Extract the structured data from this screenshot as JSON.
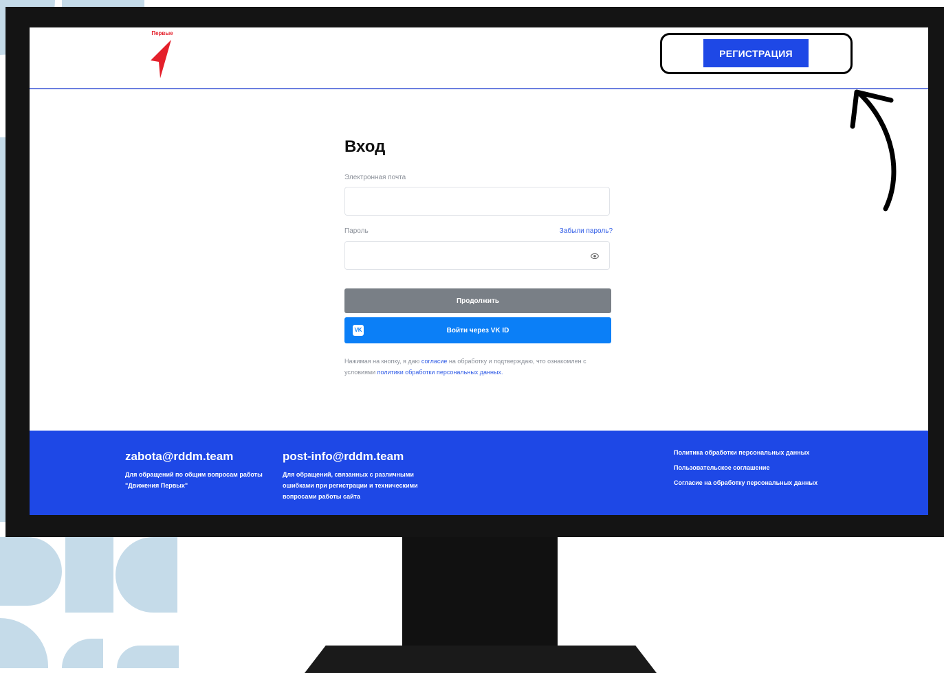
{
  "header": {
    "logo_text": "Первые",
    "register_label": "РЕГИСТРАЦИЯ"
  },
  "form": {
    "title": "Вход",
    "email_label": "Электронная почта",
    "password_label": "Пароль",
    "forgot_password": "Забыли пароль?",
    "continue_label": "Продолжить",
    "vk_login_label": "Войти через VK ID",
    "vk_icon_text": "VK",
    "consent": {
      "part1": "Нажимая на кнопку, я даю ",
      "link1": "согласие",
      "part2": " на обработку и подтверждаю, что ознакомлен с условиями ",
      "link2": "политики обработки персональных данных."
    }
  },
  "footer": {
    "contacts": [
      {
        "email": "zabota@rddm.team",
        "description": "Для обращений по общим вопросам работы \"Движения Первых\""
      },
      {
        "email": "post-info@rddm.team",
        "description": "Для обращений, связанных с различными ошибками при регистрации и техническими вопросами работы сайта"
      }
    ],
    "links": [
      "Политика обработки персональных данных",
      "Пользовательское соглашение",
      "Согласие на обработку персональных данных"
    ]
  },
  "colors": {
    "brand_blue": "#1e48e6",
    "vk_blue": "#0b7ff7",
    "continue_gray": "#797f86",
    "logo_red": "#e4202b",
    "deco_blue": "#c5dbe9"
  },
  "icons": [
    "arrow-logo-icon",
    "eye-icon",
    "vk-icon",
    "annotation-arrow-icon"
  ]
}
